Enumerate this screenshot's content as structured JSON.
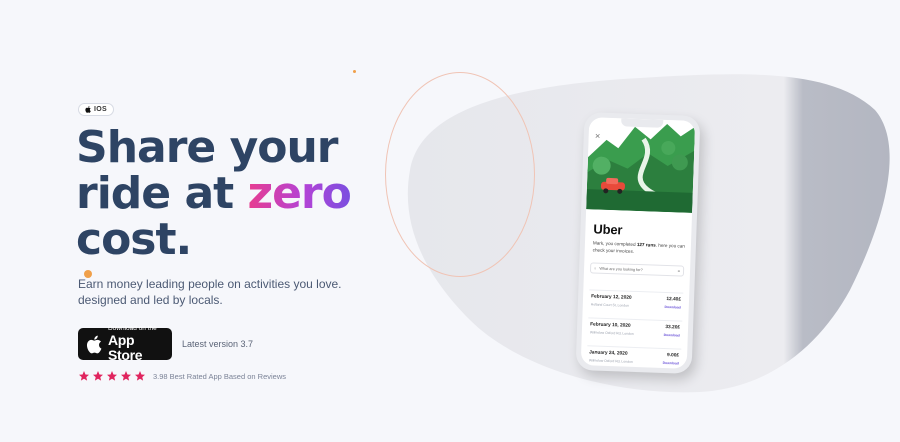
{
  "platform_badge": {
    "label": "IOS",
    "icon": "apple-icon"
  },
  "headline": {
    "line1": "Share your",
    "line2_prefix": "ride at ",
    "accent": "zero",
    "line3": "cost."
  },
  "subtext": {
    "line1": "Earn money leading people on activities you love.",
    "line2": "designed and led by locals."
  },
  "store_button": {
    "small": "Download on the",
    "big": "App Store",
    "icon": "apple-icon"
  },
  "version": "Latest version 3.7",
  "rating": {
    "stars": 5,
    "text": "3.98 Best Rated App Based on Reviews"
  },
  "colors": {
    "headline": "#2e4464",
    "accent_start": "#e83d8f",
    "accent_end": "#7a4fe0",
    "star": "#e0245e",
    "orange_dot": "#f0a04a"
  },
  "phone": {
    "close": "✕",
    "brand": "Uber",
    "message_prefix": "Mark, you completed ",
    "message_bold": "127 runs",
    "message_suffix": ". here you can check your invoices.",
    "search_placeholder": "What are you looking for?",
    "invoices": [
      {
        "date": "February 12, 2020",
        "amount": "12.40£",
        "sub": "Holland Court St, London",
        "action": "Download"
      },
      {
        "date": "February 10, 2020",
        "amount": "33.20£",
        "sub": "Wilmslow Oxford Rd, London",
        "action": "Download"
      },
      {
        "date": "January 24, 2020",
        "amount": "9.00£",
        "sub": "Wilmslow Oxford Rd, London",
        "action": "Download"
      }
    ]
  }
}
